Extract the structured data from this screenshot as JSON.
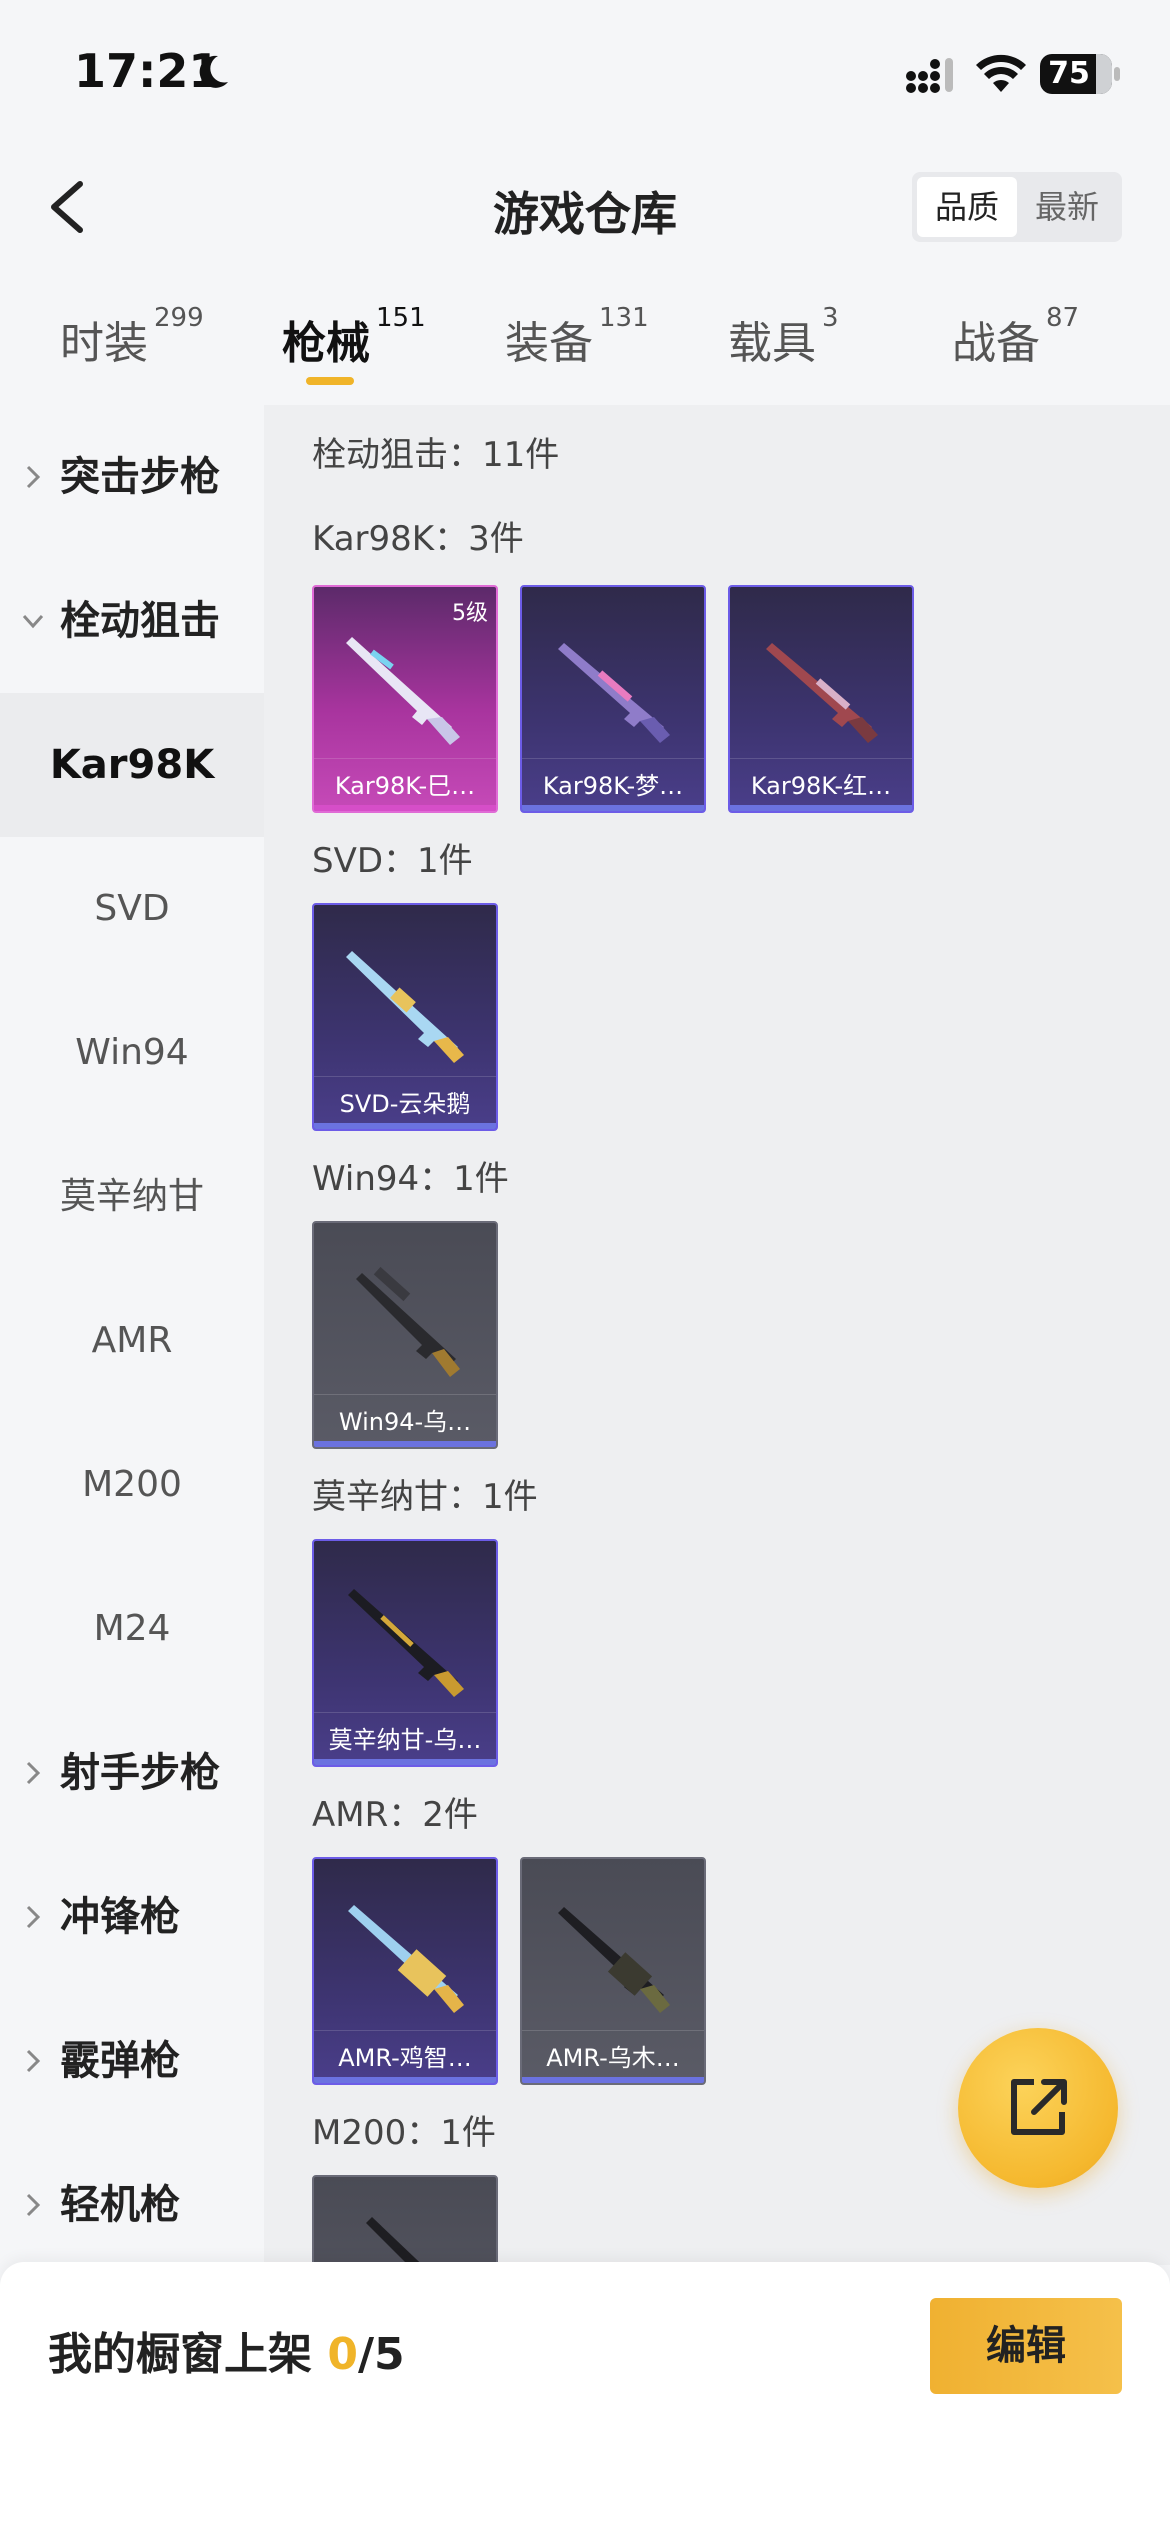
{
  "status_bar": {
    "time": "17:21",
    "battery": "75"
  },
  "nav": {
    "title": "游戏仓库",
    "sort_options": [
      "品质",
      "最新"
    ]
  },
  "tabs": [
    {
      "label": "时装",
      "count": "299"
    },
    {
      "label": "枪械",
      "count": "151"
    },
    {
      "label": "装备",
      "count": "131"
    },
    {
      "label": "载具",
      "count": "3"
    },
    {
      "label": "战备",
      "count": "87"
    }
  ],
  "sidebar": {
    "groups": [
      {
        "label": "突击步枪"
      },
      {
        "label": "栓动狙击"
      },
      {
        "label": "射手步枪"
      },
      {
        "label": "冲锋枪"
      },
      {
        "label": "霰弹枪"
      },
      {
        "label": "轻机枪"
      }
    ],
    "subitems": [
      "Kar98K",
      "SVD",
      "Win94",
      "莫辛纳甘",
      "AMR",
      "M200",
      "M24"
    ]
  },
  "content": {
    "summary": "栓动狙击：11件",
    "sections": [
      {
        "title": "Kar98K：3件",
        "cards": [
          {
            "name": "Kar98K-巳…",
            "badge": "5级",
            "style": "pink"
          },
          {
            "name": "Kar98K-梦…",
            "style": "purple"
          },
          {
            "name": "Kar98K-红…",
            "style": "purple"
          }
        ]
      },
      {
        "title": "SVD：1件",
        "cards": [
          {
            "name": "SVD-云朵鹅",
            "style": "purple"
          }
        ]
      },
      {
        "title": "Win94：1件",
        "cards": [
          {
            "name": "Win94-乌…",
            "style": "gray"
          }
        ]
      },
      {
        "title": "莫辛纳甘：1件",
        "cards": [
          {
            "name": "莫辛纳甘-乌…",
            "style": "purple"
          }
        ]
      },
      {
        "title": "AMR：2件",
        "cards": [
          {
            "name": "AMR-鸡智…",
            "style": "purple"
          },
          {
            "name": "AMR-乌木…",
            "style": "gray"
          }
        ]
      },
      {
        "title": "M200：1件",
        "cards": []
      }
    ]
  },
  "bottom": {
    "label": "我的橱窗上架 ",
    "count": "0",
    "total": "/5",
    "edit": "编辑"
  },
  "colors": {
    "accent": "#f0b429",
    "rarity_purple": "#6c5ce7",
    "rarity_pink": "#d64ec8"
  }
}
